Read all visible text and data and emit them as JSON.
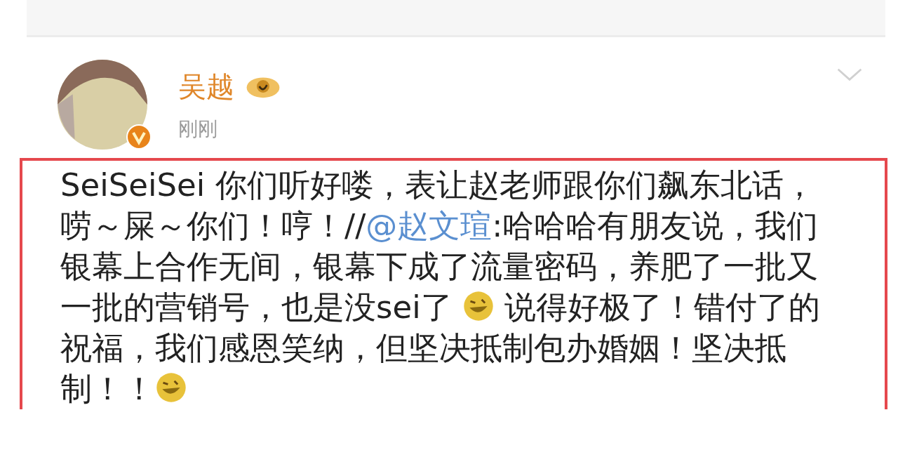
{
  "post": {
    "author": "吴越",
    "time": "刚刚",
    "verified": true,
    "highlighted": true,
    "segments": [
      {
        "kind": "text",
        "text": "SeiSeiSei 你们听好喽，表让赵老师跟你们飙东北话，唠～屎～你们！哼！//"
      },
      {
        "kind": "mention",
        "text": "@赵文瑄"
      },
      {
        "kind": "text",
        "text": ":哈哈哈有朋友说，我们银幕上合作无间，银幕下成了流量密码，养肥了一批又一批的营销号，也是没sei了 "
      },
      {
        "kind": "emoji"
      },
      {
        "kind": "text",
        "text": " 说得好极了！错付了的祝福，我们感恩笑纳，但坚决抵制包办婚姻！坚决抵制！！"
      },
      {
        "kind": "emoji"
      }
    ]
  }
}
